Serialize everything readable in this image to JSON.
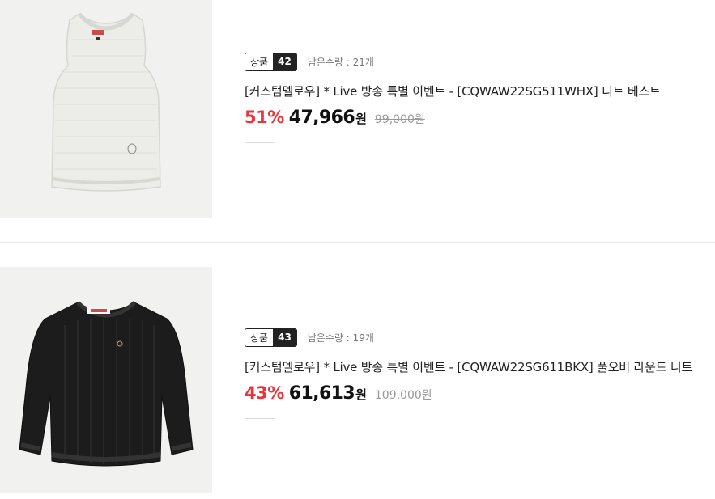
{
  "products": [
    {
      "badge_label": "상품",
      "badge_number": "42",
      "stock": "남은수량 : 21개",
      "title": "[커스텀멜로우] * Live 방송 특별 이벤트 - [CQWAW22SG511WHX] 니트 베스트",
      "discount": "51%",
      "price": "47,966",
      "currency": "원",
      "original_price": "99,000원",
      "image_icon": "white-knit-vest-image",
      "image_color": "#ecece8"
    },
    {
      "badge_label": "상품",
      "badge_number": "43",
      "stock": "남은수량 : 19개",
      "title": "[커스텀멜로우] * Live 방송 특별 이벤트 - [CQWAW22SG611BKX] 풀오버 라운드 니트",
      "discount": "43%",
      "price": "61,613",
      "currency": "원",
      "original_price": "109,000원",
      "image_icon": "black-knit-pullover-image",
      "image_color": "#1c1c1c"
    }
  ],
  "colors": {
    "discount": "#e8343a",
    "badge_dark": "#222222",
    "thumb_bg": "#f1f1f0"
  }
}
